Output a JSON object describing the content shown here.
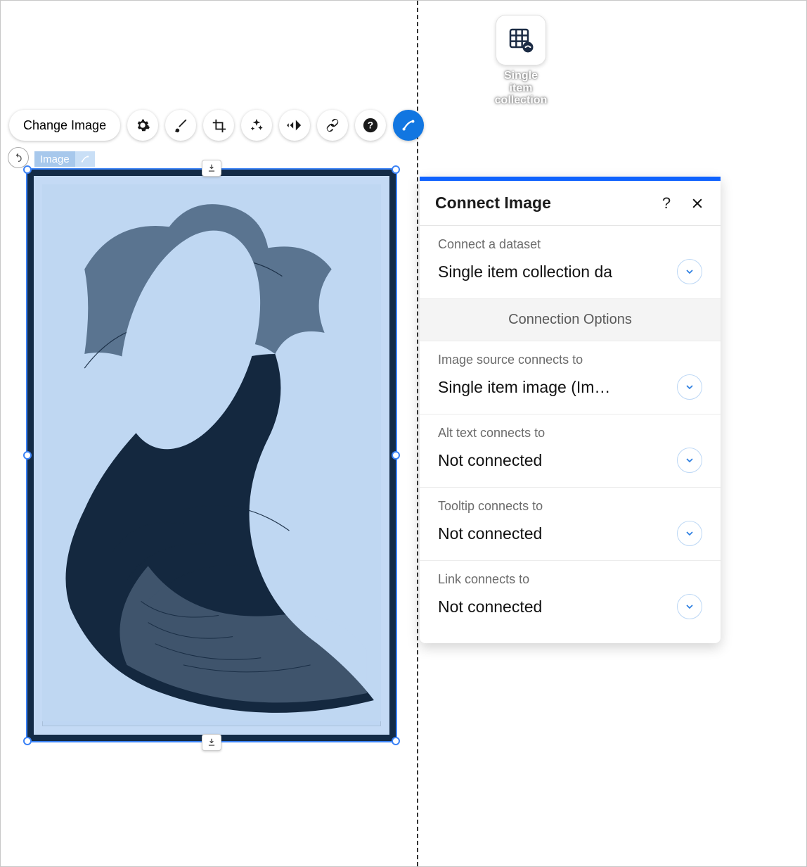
{
  "dataset_icon_caption": "Single item collection",
  "toolbar": {
    "change_image_label": "Change Image"
  },
  "element_tag": {
    "label": "Image"
  },
  "panel": {
    "title": "Connect Image",
    "connect_dataset": {
      "label": "Connect a dataset",
      "value": "Single item collection da"
    },
    "connection_options_label": "Connection Options",
    "fields": [
      {
        "label": "Image source connects to",
        "value": "Single item image (Im…"
      },
      {
        "label": "Alt text connects to",
        "value": "Not connected"
      },
      {
        "label": "Tooltip connects to",
        "value": "Not connected"
      },
      {
        "label": "Link connects to",
        "value": "Not connected"
      }
    ]
  }
}
